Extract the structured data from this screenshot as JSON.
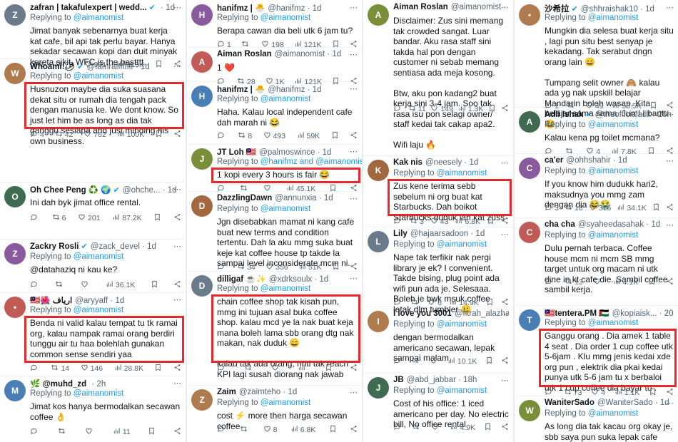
{
  "columns": [
    {
      "tweets": [
        {
          "name": "zafran | takafulexpert | wedd...",
          "handle": "",
          "time": "1d",
          "verified": true,
          "reply_prefix": "Replying to ",
          "reply_to": "@aimanomist",
          "body": "Jimat banyak sebenarnya buat kerja kat cafe, bil api tak perlu bayar. Hanya sekadar secawan kopi dan duit minyak kereta sikit. WFC is the bestttt.",
          "replies": "1",
          "retweets": "73",
          "likes": "991",
          "views": "113K"
        },
        {
          "name": "Whoami!🌶",
          "handle": "@Iamraffffffff",
          "time": "1d",
          "verified": true,
          "reply_prefix": "Replying to ",
          "reply_to": "@aimanomist",
          "body": "Husnuzon maybe dia suka suasana dekat situ or rumah dia tengah pack dengan manusia ke. We dont know. So just let him be as long as dia tak ganggu sesiapa and just minding his own business.",
          "replies": "4",
          "retweets": "42",
          "likes": "762",
          "views": "100K"
        },
        {
          "name": "Oh Chee Peng ♻️ 🌍",
          "handle": "@ohche...",
          "time": "1d",
          "verified": true,
          "reply_prefix": "",
          "reply_to": "",
          "body": "Ini dah byk jimat office rental.",
          "replies": "",
          "retweets": "6",
          "likes": "201",
          "views": "87.2K"
        },
        {
          "name": "Zackry Rosli",
          "handle": "@zack_devel",
          "time": "1d",
          "verified": true,
          "reply_prefix": "Replying to ",
          "reply_to": "@aimanomist",
          "body": "@datahaziq ni kau ke?",
          "replies": "",
          "retweets": "",
          "likes": "",
          "views": "36.1K"
        },
        {
          "name": "🇲🇾🌺 ارياف",
          "handle": "@aryyaff",
          "time": "1d",
          "verified": false,
          "reply_prefix": "Replying to ",
          "reply_to": "@aimanomist",
          "body": "Benda ni valid kalau tempat tu tk ramai org, kalau nampak ramai orang berdiri tunggu air tu haa bolehlah gunakan common sense sendiri yaa",
          "replies": "",
          "retweets": "14",
          "likes": "146",
          "views": "28.8K"
        },
        {
          "name": "🌿 @muhd_zd",
          "handle": "",
          "time": "2h",
          "verified": false,
          "reply_prefix": "Replying to ",
          "reply_to": "@aimanomist",
          "body": "Jimat kos hanya bermodalkan secawan coffee 👌",
          "replies": "",
          "retweets": "",
          "likes": "",
          "views": "11"
        }
      ]
    },
    {
      "tweets": [
        {
          "name": "hanifmz | 🐣",
          "handle": "@hanifmz",
          "time": "1d",
          "verified": false,
          "reply_prefix": "Replying to ",
          "reply_to": "@aimanomist",
          "body": "Berapa cawan dia beli utk 6 jam tu?",
          "replies": "1",
          "retweets": "",
          "likes": "198",
          "views": "121K"
        },
        {
          "name": "Aiman Roslan",
          "handle": "@aimanomist",
          "time": "1d",
          "verified": false,
          "reply_prefix": "",
          "reply_to": "",
          "body": "1 ❤️",
          "replies": "",
          "retweets": "28",
          "likes": "1K",
          "views": "121K"
        },
        {
          "name": "hanifmz | 🐣",
          "handle": "@hanifmz",
          "time": "1d",
          "verified": false,
          "reply_prefix": "Replying to ",
          "reply_to": "@aimanomist",
          "body": "Haha. Kalau local independent cafe dah marah ni 😂",
          "replies": "",
          "retweets": "8",
          "likes": "493",
          "views": "59K"
        },
        {
          "name": "JT Loh 🇲🇾",
          "handle": "@palmoswince",
          "time": "1d",
          "verified": false,
          "reply_prefix": "Replying to ",
          "reply_to": "@hanifmz and @aimanomist",
          "body": "1 kopi every 3 hours is fair 😂",
          "replies": "",
          "retweets": "",
          "likes": "",
          "views": "45.1K"
        },
        {
          "name": "DazzlingDawn",
          "handle": "@annunxia",
          "time": "1d",
          "verified": false,
          "reply_prefix": "Replying to ",
          "reply_to": "@aimanomist",
          "body": "Jgn disebabkan mamat ni kang cafe buat new terms and condition tertentu. Dah la aku mmg suka buat keje kat coffee house tp takde la sampai level inconsiderate mcm ni.",
          "replies": "",
          "retweets": "34",
          "likes": "356",
          "views": "51K"
        },
        {
          "name": "dilligaf ☕✨",
          "handle": "@xdrksoulx",
          "time": "1d",
          "verified": false,
          "reply_prefix": "Replying to ",
          "reply_to": "@aimanomist",
          "body": "chain coffee shop tak kisah pun, mmg ini tujuan asal buka coffee shop. kalau mcd ye la nak buat keja mana boleh lama sbb orang dtg nak makan, nak duduk 😄\n\nkalau tak ada orang, nnti tak reach KPI lagi susah diorang nak jawab",
          "replies": "",
          "retweets": "",
          "likes": "",
          "views": ""
        },
        {
          "name": "Zaim",
          "handle": "@zaimteho",
          "time": "1d",
          "verified": false,
          "reply_prefix": "Replying to ",
          "reply_to": "@aimanomist",
          "body": "cost ⚡ more then harga secawan coffee",
          "replies": "",
          "retweets": "",
          "likes": "8",
          "views": "6.8K"
        }
      ]
    },
    {
      "tweets": [
        {
          "name": "Aiman Roslan",
          "handle": "@aimanomist",
          "time": "12h",
          "verified": false,
          "reply_prefix": "",
          "reply_to": "",
          "body": "Disclaimer: Zus sini memang tak crowded sangat. Luar bandar. Aku rasa staff sini takda hal pon dengan customer ni sebab memang sentiasa ada meja kosong.\n\nBtw, aku pon kadang2 buat kerja sini 3-4 jam. Soo tak rasa isu pon selagi owner/ staff kedai tak cakap apa2.\n\nWifi laju 🔥",
          "replies": "",
          "retweets": "11",
          "likes": "149",
          "views": "1.3K"
        },
        {
          "name": "Kak nis",
          "handle": "@neesely",
          "time": "1d",
          "verified": false,
          "reply_prefix": "Replying to ",
          "reply_to": "@aimanomist",
          "body": "Zus kene terima sebb sebelum ni org buat kat Starbucks. Dah boikot Starbucks duduk lah kat zuss",
          "replies": "",
          "retweets": "3",
          "likes": "43",
          "views": "6.8K"
        },
        {
          "name": "Lily",
          "handle": "@hajaarsadoon",
          "time": "1d",
          "verified": false,
          "reply_prefix": "Replying to ",
          "reply_to": "@aimanomist",
          "body": "Nape tak terfikir nak pergi library je ek? I convenient. Takde bising, plug point ada wifi pun ada je. Selesaaa. Boleh je bwk msuk coffee letak dlm tumbler 🙂",
          "replies": "",
          "retweets": "",
          "likes": "6",
          "views": "14.9K"
        },
        {
          "name": "I love you 3001",
          "handle": "@fitrah_alazhar",
          "time": "1d",
          "verified": false,
          "reply_prefix": "Replying to ",
          "reply_to": "@aimanomist",
          "body": "dengan bermodalkan americano secawan, lepak sampai malam",
          "replies": "",
          "retweets": "",
          "likes": "",
          "views": "10.1K"
        },
        {
          "name": "JB",
          "handle": "@abd_jabbar",
          "time": "18h",
          "verified": false,
          "reply_prefix": "Replying to ",
          "reply_to": "@aimanomist",
          "body": "Cost of his office: 1 iced americano per day. No electric bill, No office rental",
          "replies": "",
          "retweets": "",
          "likes": "",
          "views": "4.9K"
        }
      ]
    },
    {
      "tweets": [
        {
          "name": "沙希拉",
          "handle": "@shhraishak10",
          "time": "1d",
          "verified": true,
          "reply_prefix": "Replying to ",
          "reply_to": "@aimanomist",
          "body": "Mungkin dia selesa buat kerja situ , lagi pun situ best senyap je kekadang. Tak serabut dngn orang lain 😄\n\nTumpang selit owner 🙈 kalau ada yg nak upskill belajar Mandarin boleh wasap. Kita belajar sama sama. Jum! I bantu 😂",
          "replies": "1",
          "retweets": "",
          "likes": "49",
          "views": "56.5K"
        },
        {
          "name": "Adli Ishak",
          "handle": "@theofficialadli",
          "time": "20h",
          "verified": true,
          "reply_prefix": "Replying to ",
          "reply_to": "@aimanomist",
          "body": "Kalau kena pg toilet mcmana?",
          "replies": "",
          "retweets": "",
          "likes": "4",
          "views": "7.8K"
        },
        {
          "name": "ca'er",
          "handle": "@ohhshahir",
          "time": "1d",
          "verified": false,
          "reply_prefix": "Replying to ",
          "reply_to": "@aimanomist",
          "body": "If you know him dudukk hari2, maksudnya you mmg zam dengan dia 😂😭",
          "replies": "3",
          "retweets": "18",
          "likes": "316",
          "views": "34.1K"
        },
        {
          "name": "cha cha",
          "handle": "@syaheedasahak",
          "time": "1d",
          "verified": false,
          "reply_prefix": "Replying to ",
          "reply_to": "@aimanomist",
          "body": "Dulu pernah terbaca. Coffee house mcm ni mcm SB mmg target untuk org macam ni utk dine in kt cafe die. Sambil coffee sambil kerja.",
          "replies": "",
          "retweets": "13",
          "likes": "",
          "views": "4.1K"
        },
        {
          "name": "🇲🇾tentera.PM 🇵🇸",
          "handle": "@kopiaisk...",
          "time": "20h",
          "verified": false,
          "reply_prefix": "Replying to ",
          "reply_to": "@aimanomist",
          "body": "Ganggu orang . Dia amek 1 table 4 seat . Dia order 1 cup coffee utk 5-6jam . Klu mmg jenis kedai xde org pun , elektrik dia pkai kedai punya utk 5-6 jam tu x berbaloi utk 1 cup coffee dia bayar tu .",
          "replies": "",
          "retweets": "73",
          "likes": "4",
          "views": "1.1K"
        },
        {
          "name": "WaniterSado",
          "handle": "@WaniterSado",
          "time": "1d",
          "verified": false,
          "reply_prefix": "Replying to ",
          "reply_to": "@aimanomist",
          "body": "As long dia tak kacau org okay je, sbb saya pun suka lepak cafe lama2",
          "replies": "",
          "retweets": "",
          "likes": "",
          "views": ""
        }
      ]
    }
  ],
  "colors": {
    "accent": "#1d9bf0",
    "highlight": "#e8282b",
    "muted": "#536471"
  },
  "icons": [
    "reply-icon",
    "retweet-icon",
    "like-icon",
    "views-icon",
    "bookmark-icon",
    "share-icon",
    "more-icon"
  ]
}
